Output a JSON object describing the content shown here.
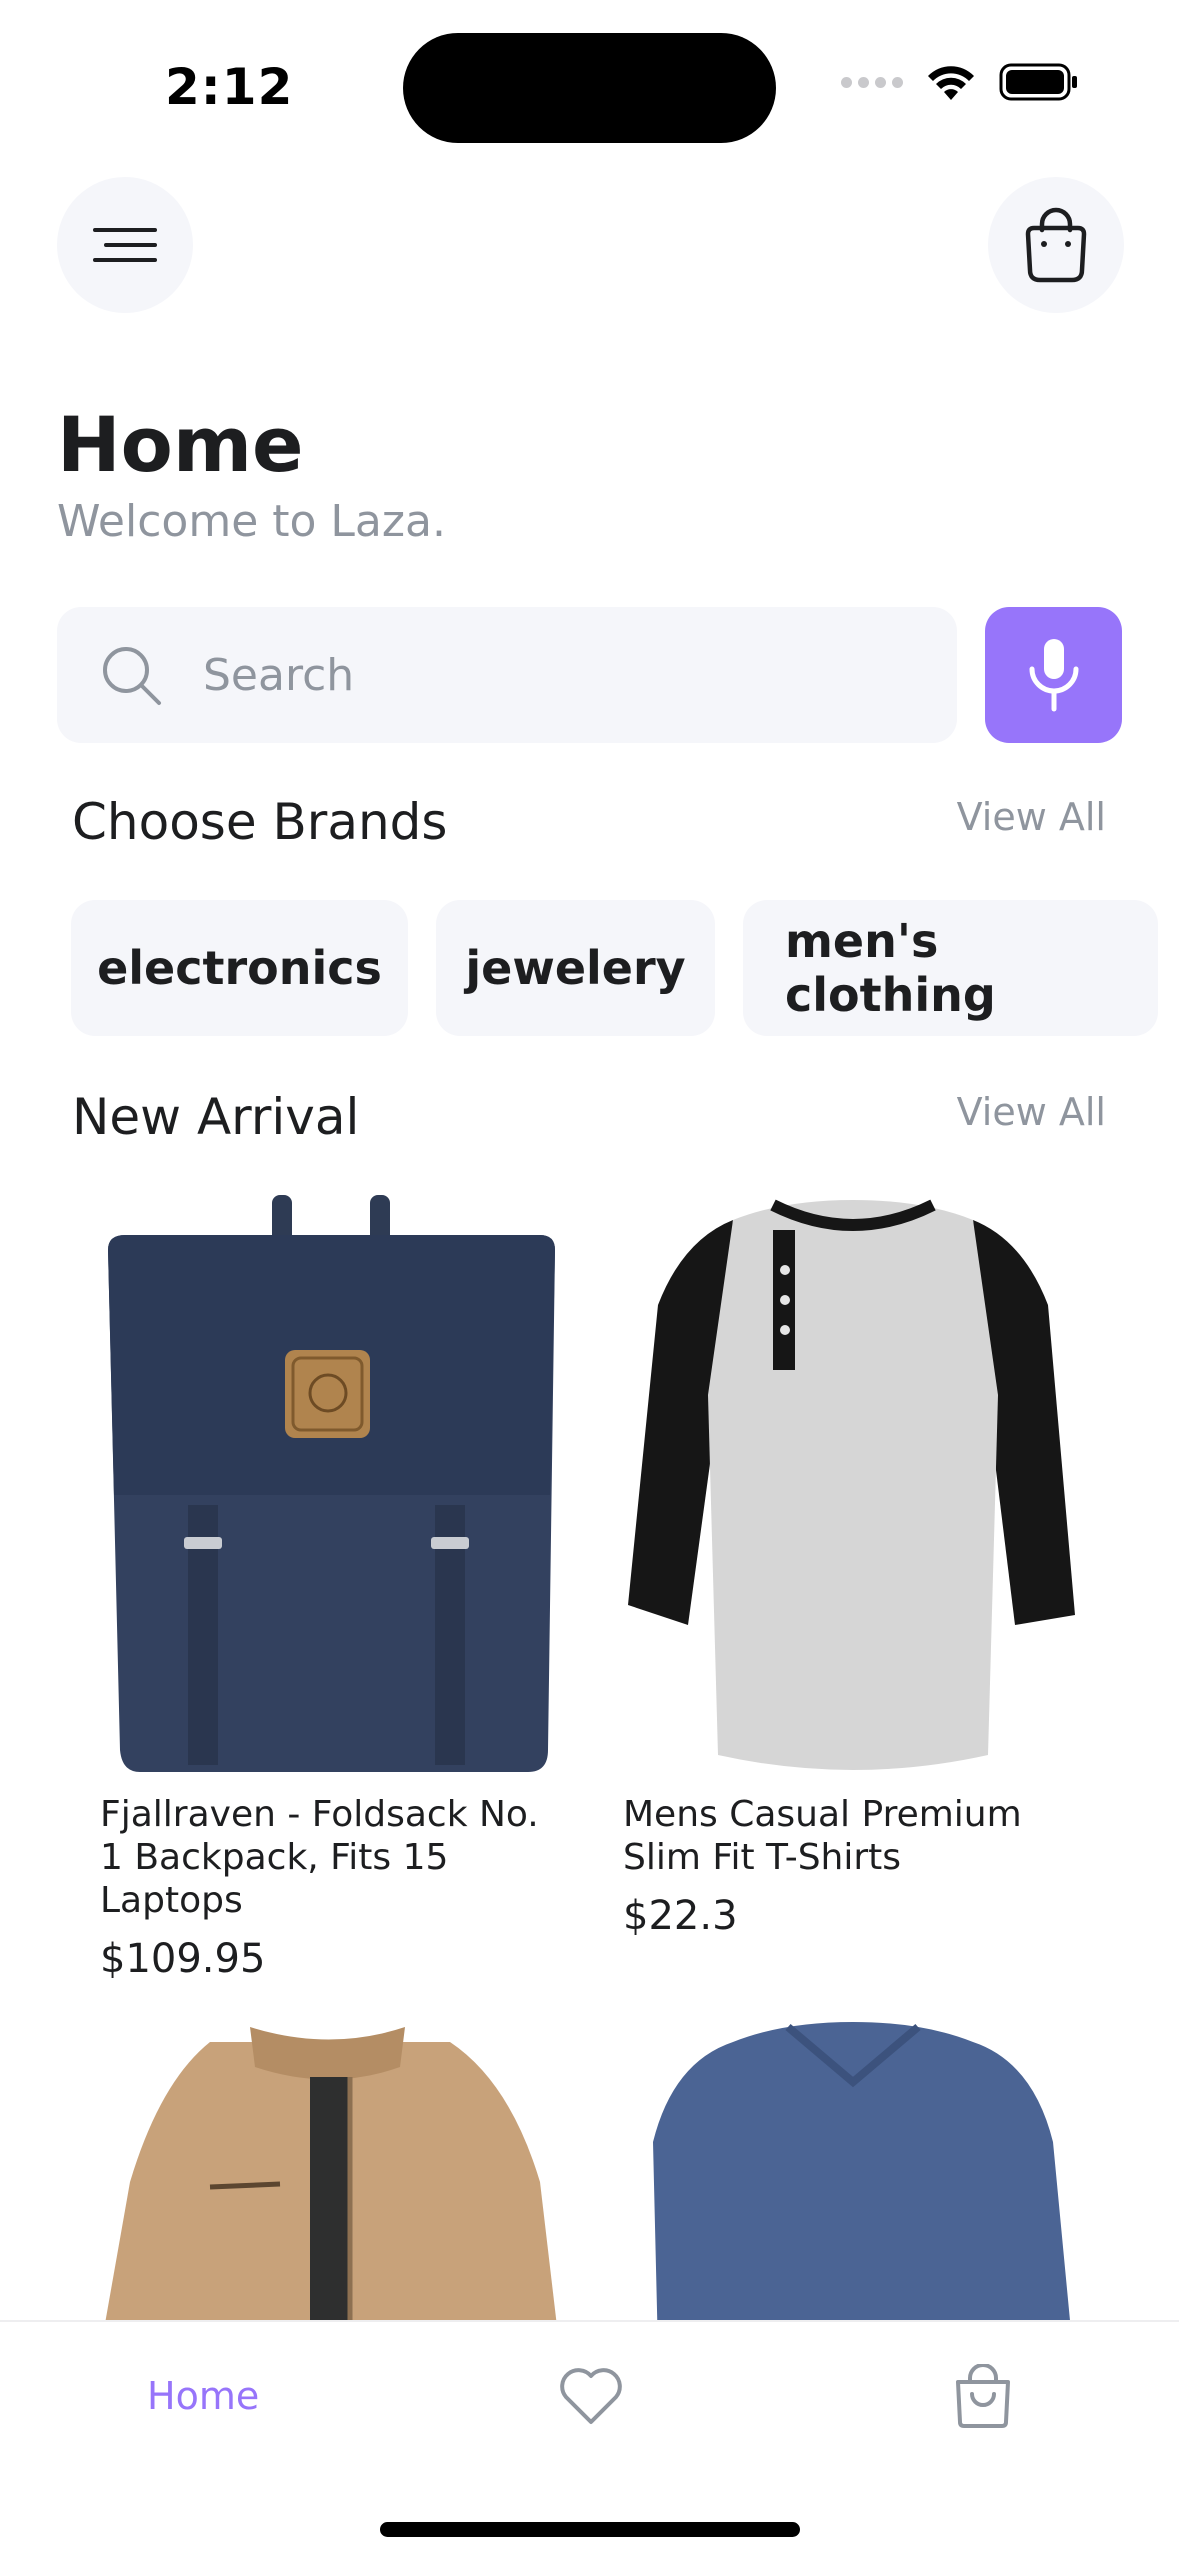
{
  "status_bar": {
    "time": "2:12"
  },
  "header": {
    "menu_icon": "menu-icon",
    "bag_icon": "shopping-bag-icon",
    "title": "Home",
    "subtitle": "Welcome to Laza."
  },
  "search": {
    "placeholder": "Search",
    "mic_icon": "microphone-icon",
    "accent_color": "#9775fa"
  },
  "brands": {
    "title": "Choose Brands",
    "view_all": "View All",
    "items": [
      {
        "label": "electronics"
      },
      {
        "label": "jewelery"
      },
      {
        "label": "men's clothing"
      }
    ]
  },
  "new_arrival": {
    "title": "New Arrival",
    "view_all": "View All",
    "products": [
      {
        "name": "Fjallraven - Foldsack No. 1 Backpack, Fits 15 Laptops",
        "price": "$109.95",
        "image": "navy-backpack"
      },
      {
        "name": "Mens Casual Premium Slim Fit T-Shirts",
        "price": "$22.3",
        "image": "raglan-henley-shirt"
      },
      {
        "name": "",
        "price": "",
        "image": "tan-jacket"
      },
      {
        "name": "",
        "price": "",
        "image": "blue-long-sleeve-shirt"
      }
    ]
  },
  "bottom_nav": {
    "home_label": "Home",
    "wishlist_icon": "heart-icon",
    "cart_icon": "shopping-bag-icon"
  }
}
